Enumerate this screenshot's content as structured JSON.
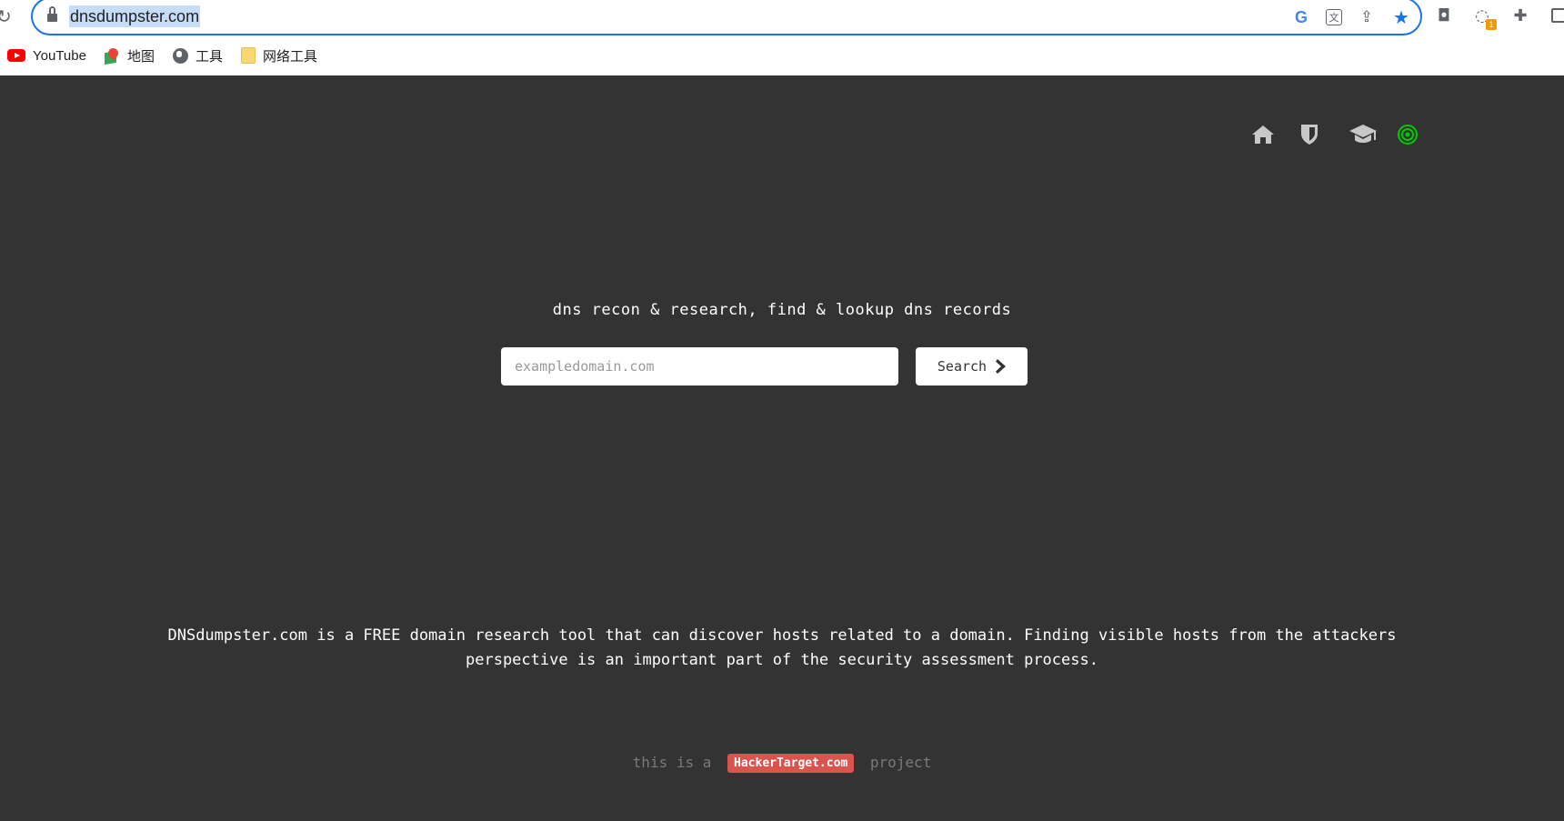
{
  "browser": {
    "url": "dnsdumpster.com",
    "toolbar": {
      "extension_badge": "1"
    },
    "bookmarks": [
      {
        "label": "YouTube",
        "icon": "youtube-icon"
      },
      {
        "label": "地图",
        "icon": "maps-icon"
      },
      {
        "label": "工具",
        "icon": "globe-icon"
      },
      {
        "label": "网络工具",
        "icon": "folder-icon"
      }
    ]
  },
  "nav": {
    "icons": [
      "home-icon",
      "shield-icon",
      "graduation-cap-icon",
      "target-icon"
    ],
    "target_color": "#00c800"
  },
  "hero": {
    "tagline": "dns recon & research, find & lookup dns records",
    "search_placeholder": "exampledomain.com",
    "search_button": "Search"
  },
  "description": "DNSdumpster.com is a FREE domain research tool that can discover hosts related to a domain. Finding visible hosts from the attackers perspective is an important part of the security assessment process.",
  "footer": {
    "prefix": "this is a",
    "link": "HackerTarget.com",
    "suffix": "project",
    "link_color": "#d9534f"
  }
}
